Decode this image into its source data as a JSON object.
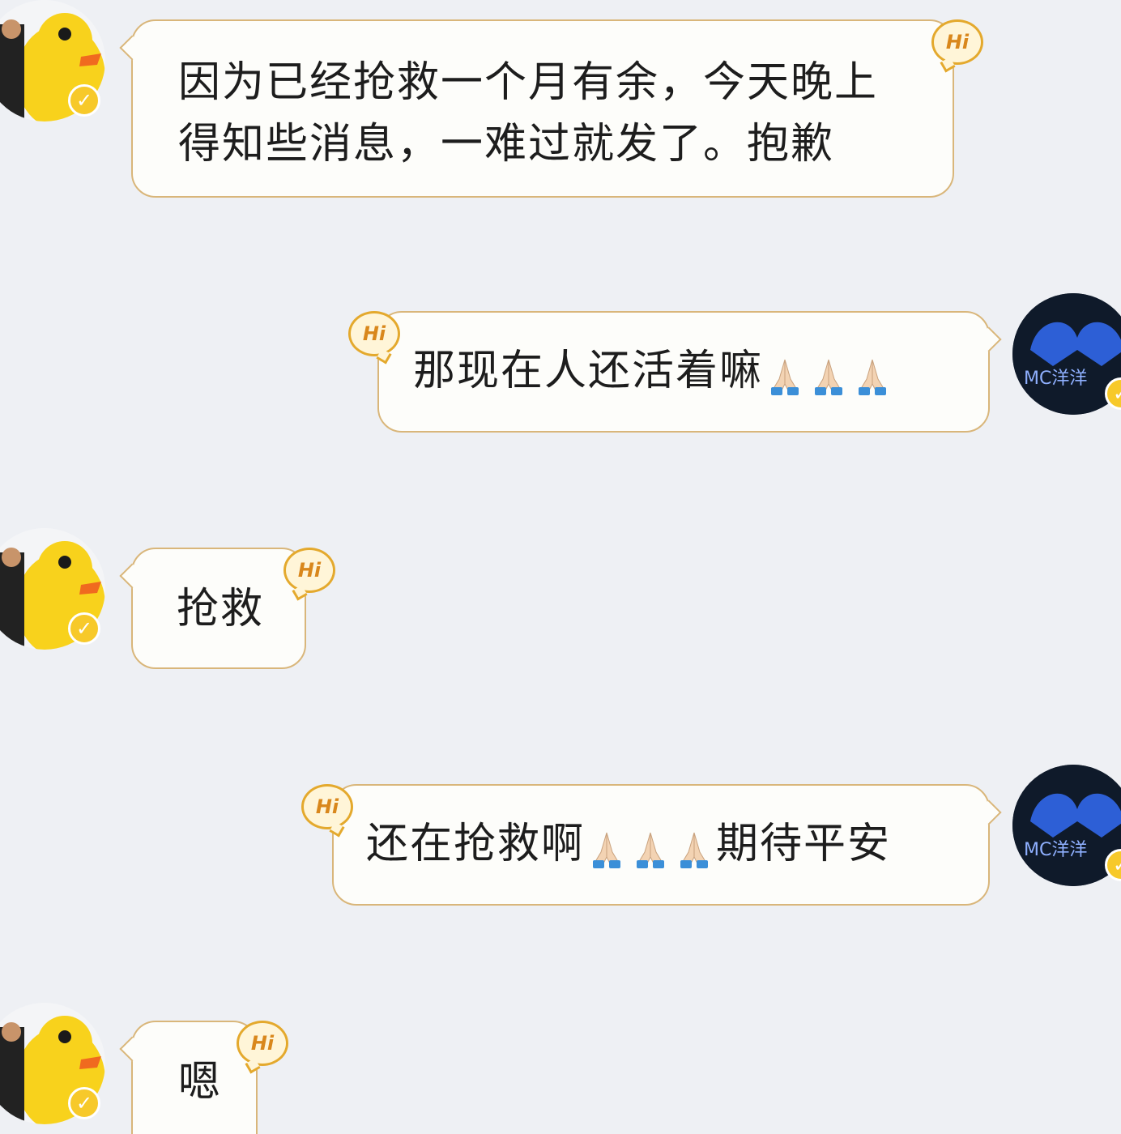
{
  "messages": [
    {
      "side": "left",
      "text": "因为已经抢救一个月有余，今天晚上\n得知些消息，一难过就发了。抱歉",
      "badge": "Hi"
    },
    {
      "side": "right",
      "text_before": "那现在人还活着嘛",
      "emoji_count": 3,
      "text_after": "",
      "badge": "Hi"
    },
    {
      "side": "left",
      "text": "抢救",
      "badge": "Hi"
    },
    {
      "side": "right",
      "text_before": "还在抢救啊",
      "emoji_count": 3,
      "text_after": "期待平安",
      "badge": "Hi"
    },
    {
      "side": "left",
      "text": "嗯",
      "badge": "Hi"
    }
  ],
  "avatars": {
    "left_icon": "rubber-duck-avatar",
    "right_icon": "blue-logo-avatar",
    "right_logo_text": "MC洋洋",
    "verified_icon": "verified-v-icon"
  },
  "colors": {
    "background": "#eef0f4",
    "bubble_border": "#d9b67a",
    "badge": "#e4a92d",
    "verified": "#f7c92a"
  }
}
